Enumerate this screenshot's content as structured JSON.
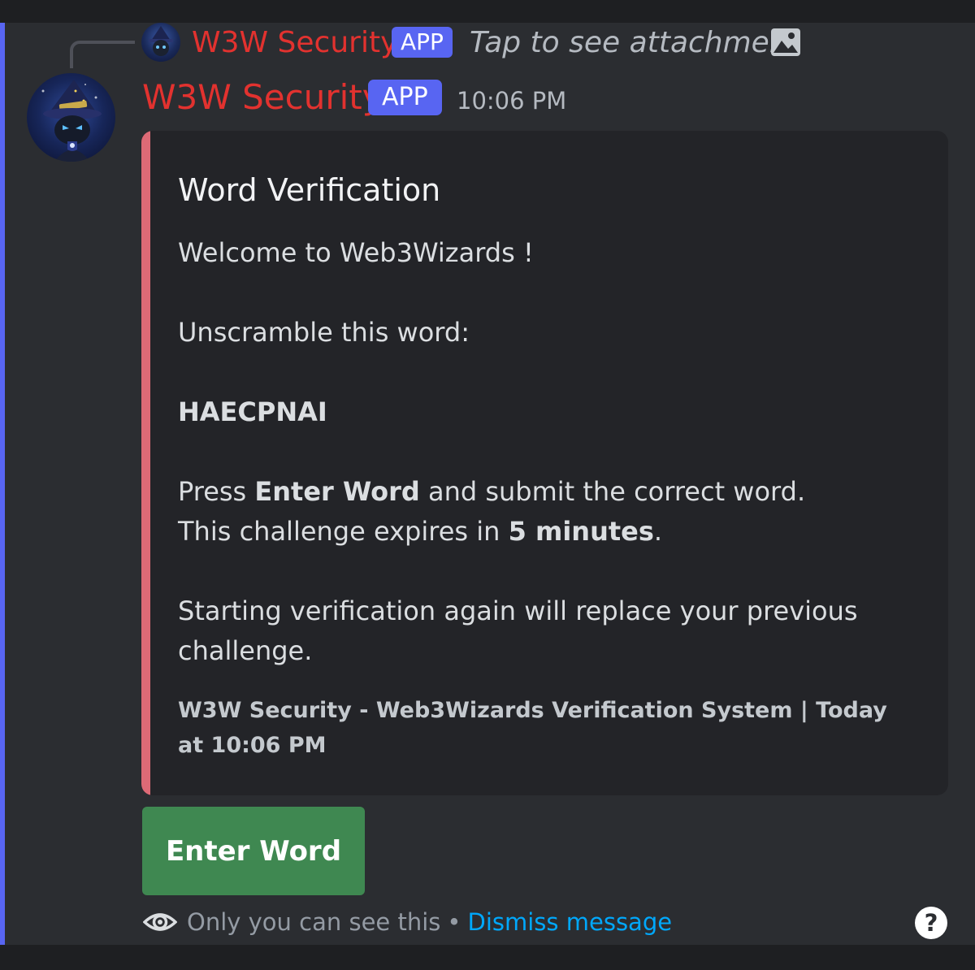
{
  "reply": {
    "author": "W3W Security",
    "badge": "APP",
    "text": "Tap to see attachment",
    "attachment_icon": "image-icon"
  },
  "message": {
    "author": "W3W Security",
    "badge": "APP",
    "timestamp": "10:06 PM",
    "avatar_icon": "wizard-avatar"
  },
  "embed": {
    "accent_color": "#dd6a76",
    "title": "Word Verification",
    "welcome": "Welcome to Web3Wizards !",
    "instruction": "Unscramble this word:",
    "scrambled_word": "HAECPNAI",
    "press_prefix": "Press ",
    "press_bold": "Enter Word",
    "press_suffix": " and submit the correct word.",
    "expires_prefix": "This challenge expires in ",
    "expires_bold": "5 minutes",
    "expires_suffix": ".",
    "restart_note": "Starting verification again will replace your previous challenge.",
    "footer": "W3W Security - Web3Wizards Verification System | Today at 10:06 PM"
  },
  "button": {
    "label": "Enter Word",
    "color": "#3f8851"
  },
  "ephemeral": {
    "icon": "eye-icon",
    "text": "Only you can see this",
    "separator": "•",
    "dismiss": "Dismiss message",
    "help_icon": "help-icon",
    "help_symbol": "?"
  },
  "colors": {
    "author": "#e2322f",
    "app_badge": "#5865f2",
    "link": "#00a8fc",
    "highlight_bar": "#5865f2"
  }
}
